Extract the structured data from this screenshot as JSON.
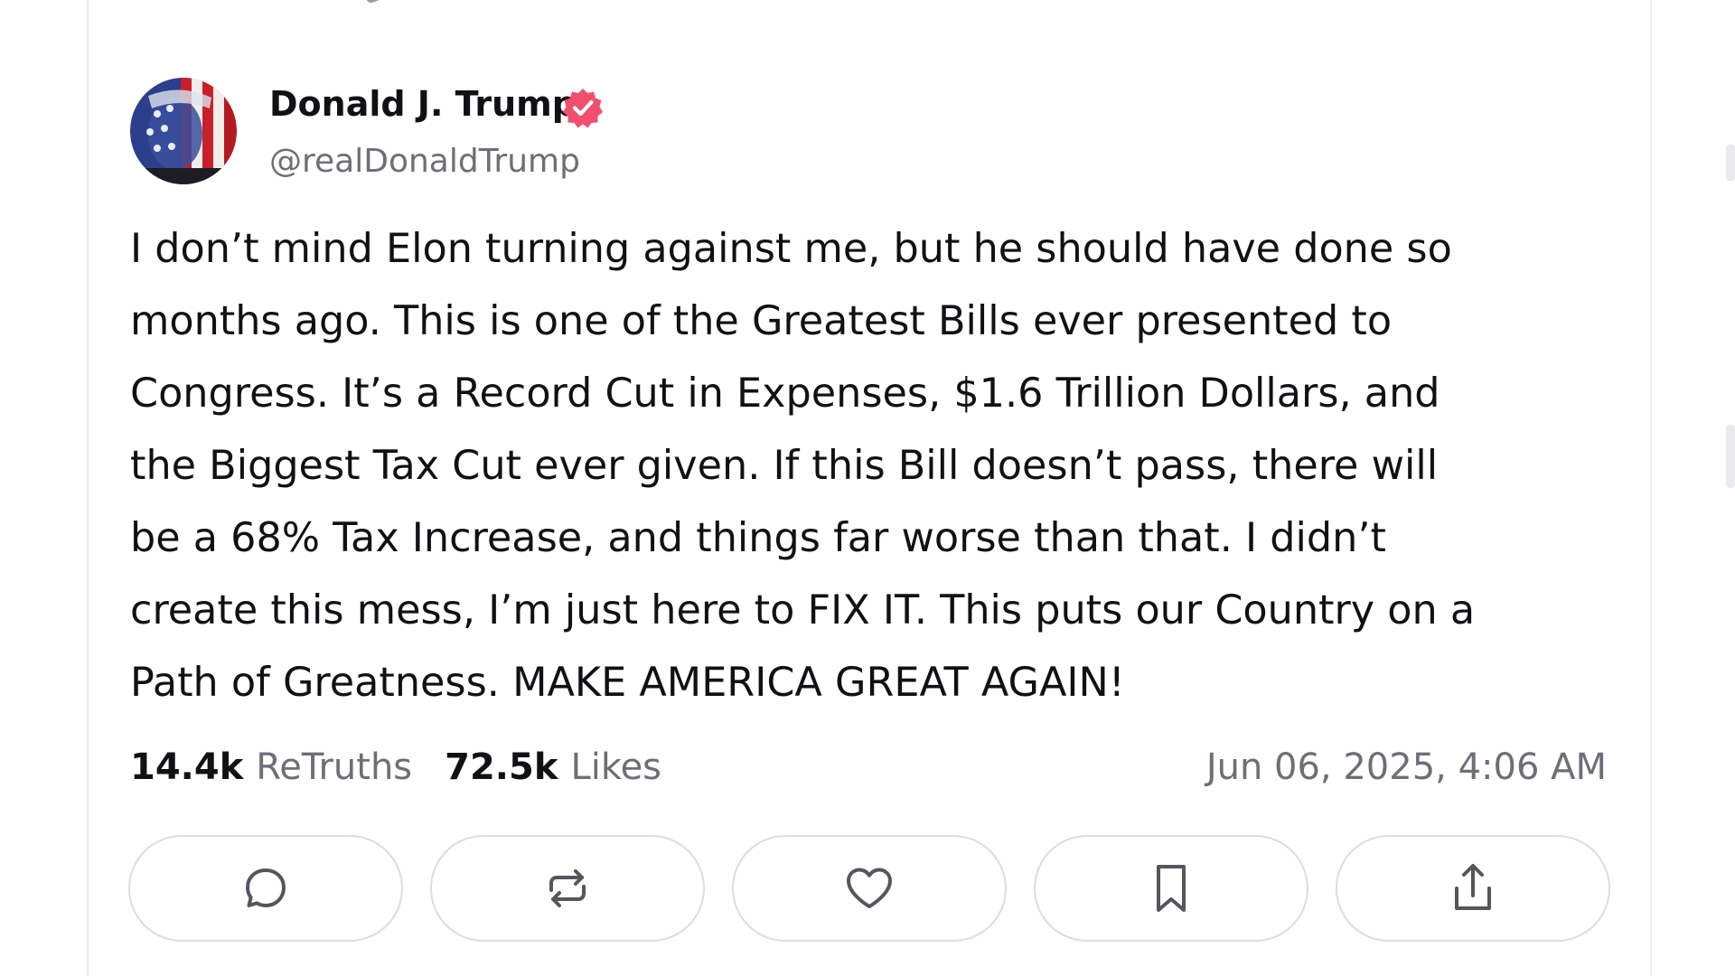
{
  "post": {
    "author": {
      "display_name": "Donald J. Trump",
      "handle": "@realDonaldTrump",
      "verified": true,
      "verified_color": "#f0506e"
    },
    "text": "I don’t mind Elon turning against me, but he should have done so\nmonths ago. This is one of the Greatest Bills ever presented to\nCongress. It’s a Record Cut in Expenses, $1.6 Trillion Dollars, and\nthe Biggest Tax Cut ever given. If this Bill doesn’t pass, there will\nbe a 68% Tax Increase, and things far worse than that. I didn’t\ncreate this mess, I’m just here to FIX IT. This puts our Country on a\nPath of Greatness. MAKE AMERICA GREAT AGAIN!",
    "stats": {
      "retruths_count": "14.4k",
      "retruths_label": "ReTruths",
      "likes_count": "72.5k",
      "likes_label": "Likes"
    },
    "timestamp": "Jun 06, 2025, 4:06 AM"
  },
  "actions": [
    {
      "name": "reply",
      "icon": "comment-icon"
    },
    {
      "name": "retruth",
      "icon": "repost-icon"
    },
    {
      "name": "like",
      "icon": "heart-icon"
    },
    {
      "name": "bookmark",
      "icon": "bookmark-icon"
    },
    {
      "name": "share",
      "icon": "share-icon"
    }
  ],
  "colors": {
    "text_primary": "#111115",
    "text_secondary": "#6e6e78",
    "border": "#dcdce2"
  }
}
